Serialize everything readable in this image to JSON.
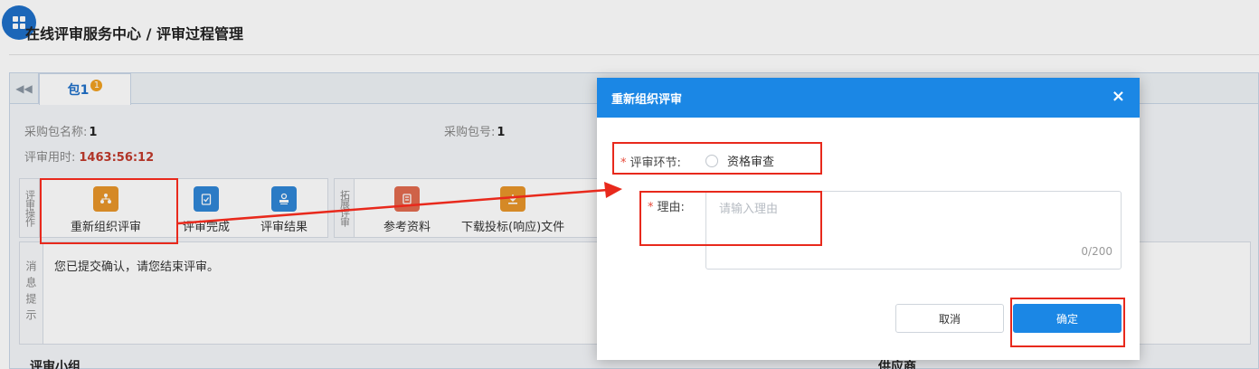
{
  "header": {
    "title": "在线评审服务中心 / 评审过程管理"
  },
  "tabs": [
    {
      "label": "包1",
      "badge": "1"
    }
  ],
  "package_info": {
    "name_label": "采购包名称:",
    "name_value": "1",
    "number_label": "采购包号:",
    "number_value": "1",
    "time_label": "评审用时:",
    "time_value": "1463:56:12"
  },
  "review_ops": {
    "section_label": "评审操作",
    "items": [
      {
        "label": "重新组织评审",
        "icon": "org-icon"
      },
      {
        "label": "评审完成",
        "icon": "clipboard-check-icon"
      },
      {
        "label": "评审结果",
        "icon": "stamp-icon"
      }
    ]
  },
  "extend_ops": {
    "section_label": "拓展评审",
    "items": [
      {
        "label": "参考资料",
        "icon": "document-icon"
      },
      {
        "label": "下载投标(响应)文件",
        "icon": "download-icon"
      }
    ]
  },
  "messages": {
    "label": "消息提示",
    "text": "您已提交确认，请您结束评审。"
  },
  "sections": {
    "review_group": "评审小组",
    "suppliers": "供应商"
  },
  "dialog": {
    "title": "重新组织评审",
    "close_glyph": "×",
    "stage_label": "评审环节:",
    "stage_option": "资格审查",
    "reason_label": "理由:",
    "reason_placeholder": "请输入理由",
    "reason_value": "",
    "char_count": "0/200",
    "cancel_label": "取消",
    "ok_label": "确定"
  },
  "colors": {
    "primary": "#1b87e5",
    "annotation": "#e8291c",
    "timer": "#c0392b",
    "required": "#e74c3c"
  }
}
